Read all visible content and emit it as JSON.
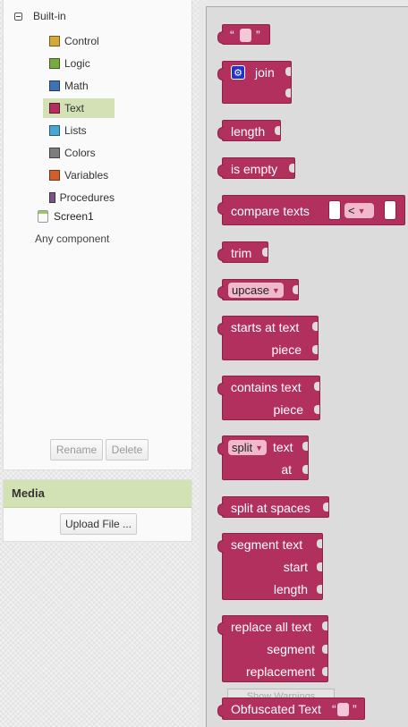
{
  "palette": {
    "root_label": "Built-in",
    "categories": [
      {
        "label": "Control",
        "color": "#d4a83a"
      },
      {
        "label": "Logic",
        "color": "#77ab41"
      },
      {
        "label": "Math",
        "color": "#3f71b5"
      },
      {
        "label": "Text",
        "color": "#b32d5e"
      },
      {
        "label": "Lists",
        "color": "#49a6d4"
      },
      {
        "label": "Colors",
        "color": "#7d7d7d"
      },
      {
        "label": "Variables",
        "color": "#d05f2d"
      },
      {
        "label": "Procedures",
        "color": "#7c5385"
      }
    ],
    "selected": "Text",
    "screen_label": "Screen1",
    "any_component": "Any component",
    "rename_label": "Rename",
    "delete_label": "Delete"
  },
  "media": {
    "title": "Media",
    "upload_label": "Upload File ..."
  },
  "workspace": {
    "blocks": {
      "text_open_quote": "“",
      "text_close_quote": "”",
      "join": "join",
      "length": "length",
      "is_empty": "is empty",
      "compare_texts": "compare texts",
      "compare_op": "<",
      "trim": "trim",
      "upcase": "upcase",
      "starts_at_text": "starts at  text",
      "starts_at_piece": "piece",
      "contains_text": "contains  text",
      "contains_piece": "piece",
      "split": "split",
      "split_text": "text",
      "split_at": "at",
      "split_at_spaces": "split at spaces",
      "segment_text": "segment  text",
      "segment_start": "start",
      "segment_length": "length",
      "replace_all_text": "replace all text",
      "replace_segment": "segment",
      "replace_replacement": "replacement",
      "obfuscated_text": "Obfuscated Text",
      "obfuscated_open_quote": "“",
      "obfuscated_close_quote": "”"
    },
    "ghost_button": "Show Warnings"
  }
}
